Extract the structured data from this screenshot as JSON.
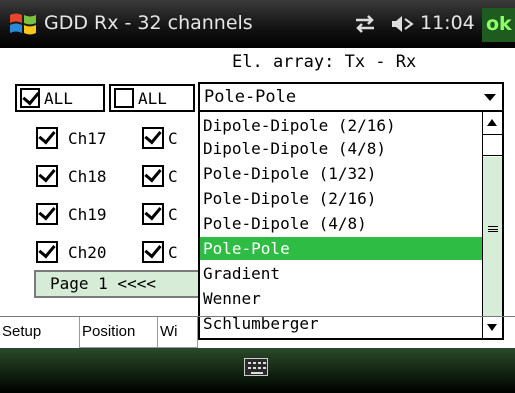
{
  "titlebar": {
    "title": "GDD Rx - 32 channels",
    "clock": "11:04",
    "ok_label": "ok",
    "icons": [
      "windows-start-icon",
      "connectivity-icon",
      "volume-icon"
    ]
  },
  "array_label": "El. array: Tx - Rx",
  "check_all_left": {
    "label": "ALL",
    "checked": true
  },
  "check_all_right": {
    "label": "ALL",
    "checked": false
  },
  "combo": {
    "value": "Pole-Pole"
  },
  "channels": [
    {
      "label": "Ch17",
      "second_label": "C"
    },
    {
      "label": "Ch18",
      "second_label": "C"
    },
    {
      "label": "Ch19",
      "second_label": "C"
    },
    {
      "label": "Ch20",
      "second_label": "C"
    }
  ],
  "page_nav": "Page 1 <<<<",
  "dropdown": {
    "items": [
      "Dipole-Dipole (2/16)",
      "Dipole-Dipole (4/8)",
      "Pole-Dipole (1/32)",
      "Pole-Dipole (2/16)",
      "Pole-Dipole (4/8)",
      "Pole-Pole",
      "Gradient",
      "Wenner",
      "Schlumberger"
    ],
    "selected": "Pole-Pole"
  },
  "tabs": [
    "Setup",
    "Position",
    "Wi"
  ],
  "colors": {
    "selection": "#2fbc45",
    "accent_green": "#d6ecd6",
    "ok_text": "#8dff6a"
  }
}
